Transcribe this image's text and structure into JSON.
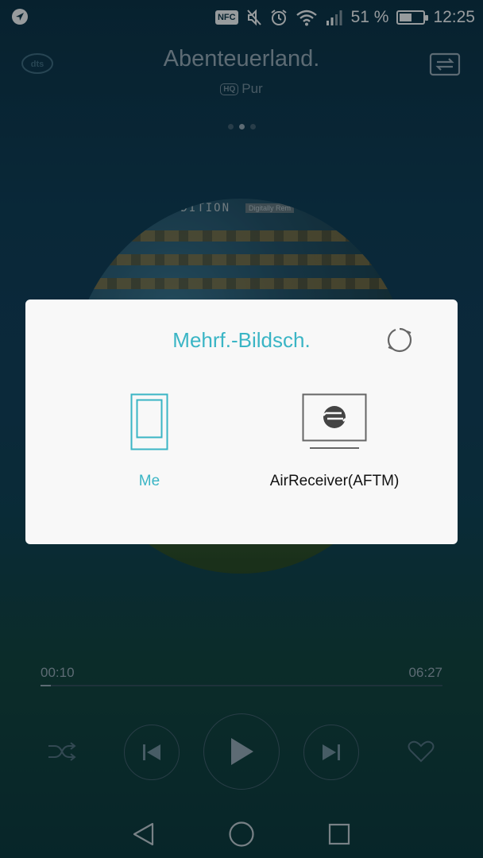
{
  "status_bar": {
    "battery_percent": "51 %",
    "battery_level": 0.51,
    "time": "12:25",
    "nfc_label": "NFC",
    "icons": [
      "location-arrow-icon",
      "nfc-icon",
      "mute-icon",
      "alarm-icon",
      "wifi-icon",
      "signal-icon",
      "battery-icon"
    ]
  },
  "player": {
    "title": "Abenteuerland.",
    "hq_badge": "HQ",
    "artist": "Pur",
    "page_dots": 3,
    "active_dot": 1,
    "album_text_1": "EDITION",
    "album_text_2": "Digitally Rem",
    "elapsed": "00:10",
    "duration": "06:27",
    "progress_fraction": 0.026
  },
  "dialog": {
    "title": "Mehrf.-Bildsch.",
    "devices": [
      {
        "label": "Me",
        "icon": "phone-icon",
        "selected": true
      },
      {
        "label": "AirReceiver(AFTM)",
        "icon": "tv-icon",
        "selected": false
      }
    ]
  },
  "colors": {
    "accent": "#3ab5c5",
    "dialog_bg": "#f8f8f8"
  }
}
